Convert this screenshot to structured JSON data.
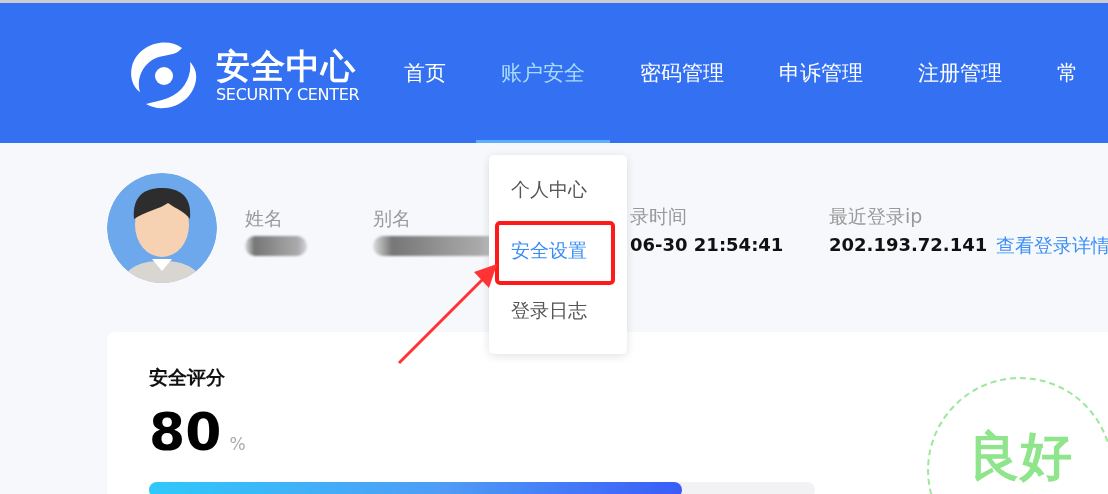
{
  "header": {
    "logo_title": "安全中心",
    "logo_subtitle": "SECURITY CENTER",
    "nav": [
      {
        "label": "首页",
        "selected": false
      },
      {
        "label": "账户安全",
        "selected": true
      },
      {
        "label": "密码管理",
        "selected": false
      },
      {
        "label": "申诉管理",
        "selected": false
      },
      {
        "label": "注册管理",
        "selected": false
      },
      {
        "label": "常",
        "selected": false
      }
    ]
  },
  "profile": {
    "fields": [
      {
        "label": "姓名",
        "kind": "blurred"
      },
      {
        "label": "别名",
        "kind": "blurred"
      },
      {
        "label": "录时间",
        "kind": "text",
        "value": "06-30 21:54:41"
      },
      {
        "label": "最近登录ip",
        "kind": "text",
        "value": "202.193.72.141"
      }
    ],
    "link": "查看登录详情"
  },
  "dropdown": {
    "items": [
      {
        "label": "个人中心",
        "selected": false
      },
      {
        "label": "安全设置",
        "selected": true
      },
      {
        "label": "登录日志",
        "selected": false
      }
    ]
  },
  "score": {
    "title": "安全评分",
    "value": "80",
    "unit": "%",
    "level": 0.8,
    "rating": "良好"
  }
}
